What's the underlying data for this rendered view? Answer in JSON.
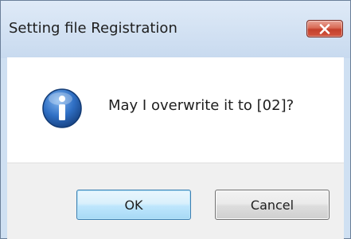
{
  "window": {
    "title": "Setting file Registration",
    "close_icon": "close-icon"
  },
  "message": {
    "icon": "info-icon",
    "text": "May I overwrite it to [02]?"
  },
  "buttons": {
    "ok_label": "OK",
    "cancel_label": "Cancel"
  },
  "colors": {
    "close_button": "#c4402c",
    "info_icon": "#1f5aa8",
    "default_button_border": "#3c7fb1"
  }
}
